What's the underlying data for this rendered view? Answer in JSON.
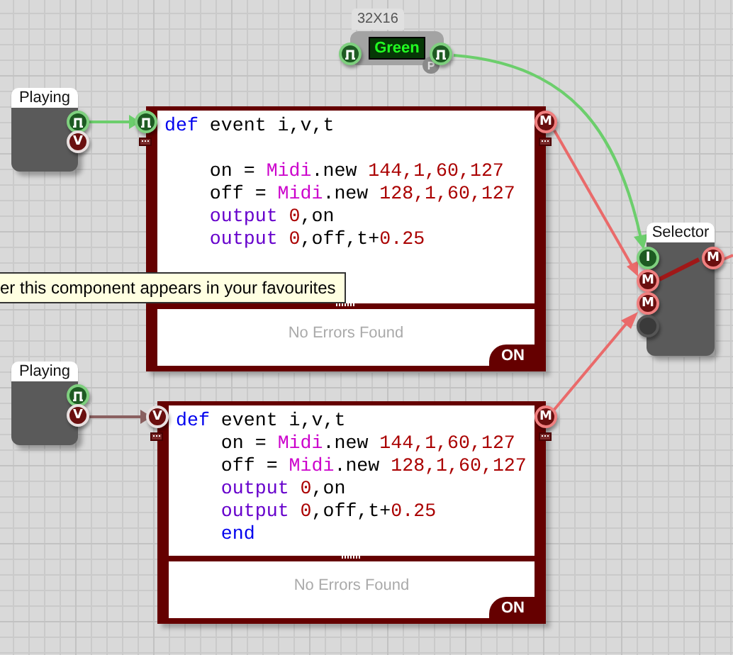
{
  "players": [
    {
      "label": "Playing",
      "ports": [
        {
          "kind": "pulse"
        },
        {
          "kind": "value",
          "glyph": "V"
        }
      ]
    },
    {
      "label": "Playing",
      "ports": [
        {
          "kind": "pulse"
        },
        {
          "kind": "value",
          "glyph": "V"
        }
      ]
    }
  ],
  "display_node": {
    "label": "32X16",
    "value": "Green",
    "badge": "P",
    "ports": [
      {
        "kind": "pulse"
      },
      {
        "kind": "pulse"
      }
    ]
  },
  "code_blocks": [
    {
      "input": {
        "kind": "pulse"
      },
      "output": {
        "kind": "midi",
        "glyph": "M"
      },
      "lines": [
        {
          "kind": "code",
          "tokens": [
            {
              "kind": "kw",
              "text": "def"
            },
            {
              "kind": "id",
              "text": " event i,v,t"
            }
          ]
        },
        {
          "kind": "blank"
        },
        {
          "kind": "code",
          "tokens": [
            {
              "kind": "id",
              "text": "    on = "
            },
            {
              "kind": "cls",
              "text": "Midi"
            },
            {
              "kind": "id",
              "text": ".new "
            },
            {
              "kind": "num",
              "text": "144,1,60,127"
            }
          ]
        },
        {
          "kind": "code",
          "tokens": [
            {
              "kind": "id",
              "text": "    off = "
            },
            {
              "kind": "cls",
              "text": "Midi"
            },
            {
              "kind": "id",
              "text": ".new "
            },
            {
              "kind": "num",
              "text": "128,1,60,127"
            }
          ]
        },
        {
          "kind": "code",
          "tokens": [
            {
              "kind": "fn",
              "text": "    output "
            },
            {
              "kind": "num",
              "text": "0"
            },
            {
              "kind": "id",
              "text": ",on"
            }
          ]
        },
        {
          "kind": "code",
          "tokens": [
            {
              "kind": "fn",
              "text": "    output "
            },
            {
              "kind": "num",
              "text": "0"
            },
            {
              "kind": "id",
              "text": ",off,t+"
            },
            {
              "kind": "num",
              "text": "0.25"
            }
          ]
        }
      ],
      "status": "No Errors Found",
      "toggle": "ON"
    },
    {
      "input": {
        "kind": "value",
        "glyph": "V"
      },
      "output": {
        "kind": "midi",
        "glyph": "M"
      },
      "lines": [
        {
          "kind": "code",
          "tokens": [
            {
              "kind": "kw",
              "text": "def"
            },
            {
              "kind": "id",
              "text": " event i,v,t"
            }
          ]
        },
        {
          "kind": "code",
          "tokens": [
            {
              "kind": "id",
              "text": "    on = "
            },
            {
              "kind": "cls",
              "text": "Midi"
            },
            {
              "kind": "id",
              "text": ".new "
            },
            {
              "kind": "num",
              "text": "144,1,60,127"
            }
          ]
        },
        {
          "kind": "code",
          "tokens": [
            {
              "kind": "id",
              "text": "    off = "
            },
            {
              "kind": "cls",
              "text": "Midi"
            },
            {
              "kind": "id",
              "text": ".new "
            },
            {
              "kind": "num",
              "text": "128,1,60,127"
            }
          ]
        },
        {
          "kind": "code",
          "tokens": [
            {
              "kind": "fn",
              "text": "    output "
            },
            {
              "kind": "num",
              "text": "0"
            },
            {
              "kind": "id",
              "text": ",on"
            }
          ]
        },
        {
          "kind": "code",
          "tokens": [
            {
              "kind": "fn",
              "text": "    output "
            },
            {
              "kind": "num",
              "text": "0"
            },
            {
              "kind": "id",
              "text": ",off,t+"
            },
            {
              "kind": "num",
              "text": "0.25"
            }
          ]
        },
        {
          "kind": "code",
          "tokens": [
            {
              "kind": "kw",
              "text": "    end"
            }
          ]
        }
      ],
      "status": "No Errors Found",
      "toggle": "ON"
    }
  ],
  "selector": {
    "label": "Selector",
    "inputs": [
      {
        "kind": "int",
        "glyph": "I"
      },
      {
        "kind": "midi",
        "glyph": "M"
      },
      {
        "kind": "midi",
        "glyph": "M"
      },
      {
        "kind": "empty"
      }
    ],
    "output": {
      "kind": "midi",
      "glyph": "M"
    }
  },
  "tooltip": {
    "text": "er this component appears in your favourites"
  }
}
